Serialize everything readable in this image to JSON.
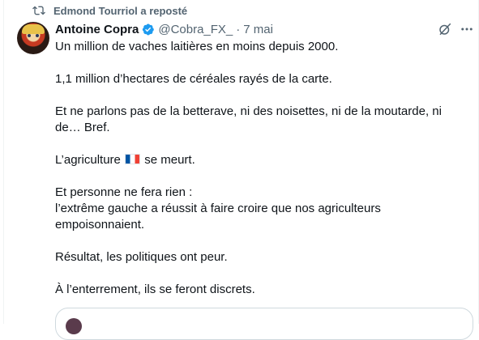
{
  "repost": {
    "label": "Edmond Tourriol a reposté",
    "icon": "repost-icon"
  },
  "tweet": {
    "author": {
      "name": "Antoine Copra",
      "handle": "@Cobra_FX_",
      "verified": true
    },
    "separator": "·",
    "time": "7 mai",
    "lines": [
      "Un million de vaches laitières en moins depuis 2000.",
      "1,1 million d’hectares de céréales rayés de la carte.",
      "Et ne parlons pas de la betterave, ni des noisettes, ni de la moutarde, ni de… Bref.",
      "L’agriculture",
      "se meurt.",
      "Et personne ne fera rien :",
      "l’extrême gauche a réussit à faire croire que nos agriculteurs empoisonnaient.",
      "Résultat, les politiques ont peur.",
      "À l’enterrement, ils se feront discrets."
    ],
    "emoji": "🇫🇷",
    "icons": [
      "grok-icon",
      "more-icon",
      "verified-badge-icon"
    ]
  },
  "colors": {
    "verified": "#1d9bf0",
    "secondary": "#536471",
    "border": "#cfd9de"
  }
}
